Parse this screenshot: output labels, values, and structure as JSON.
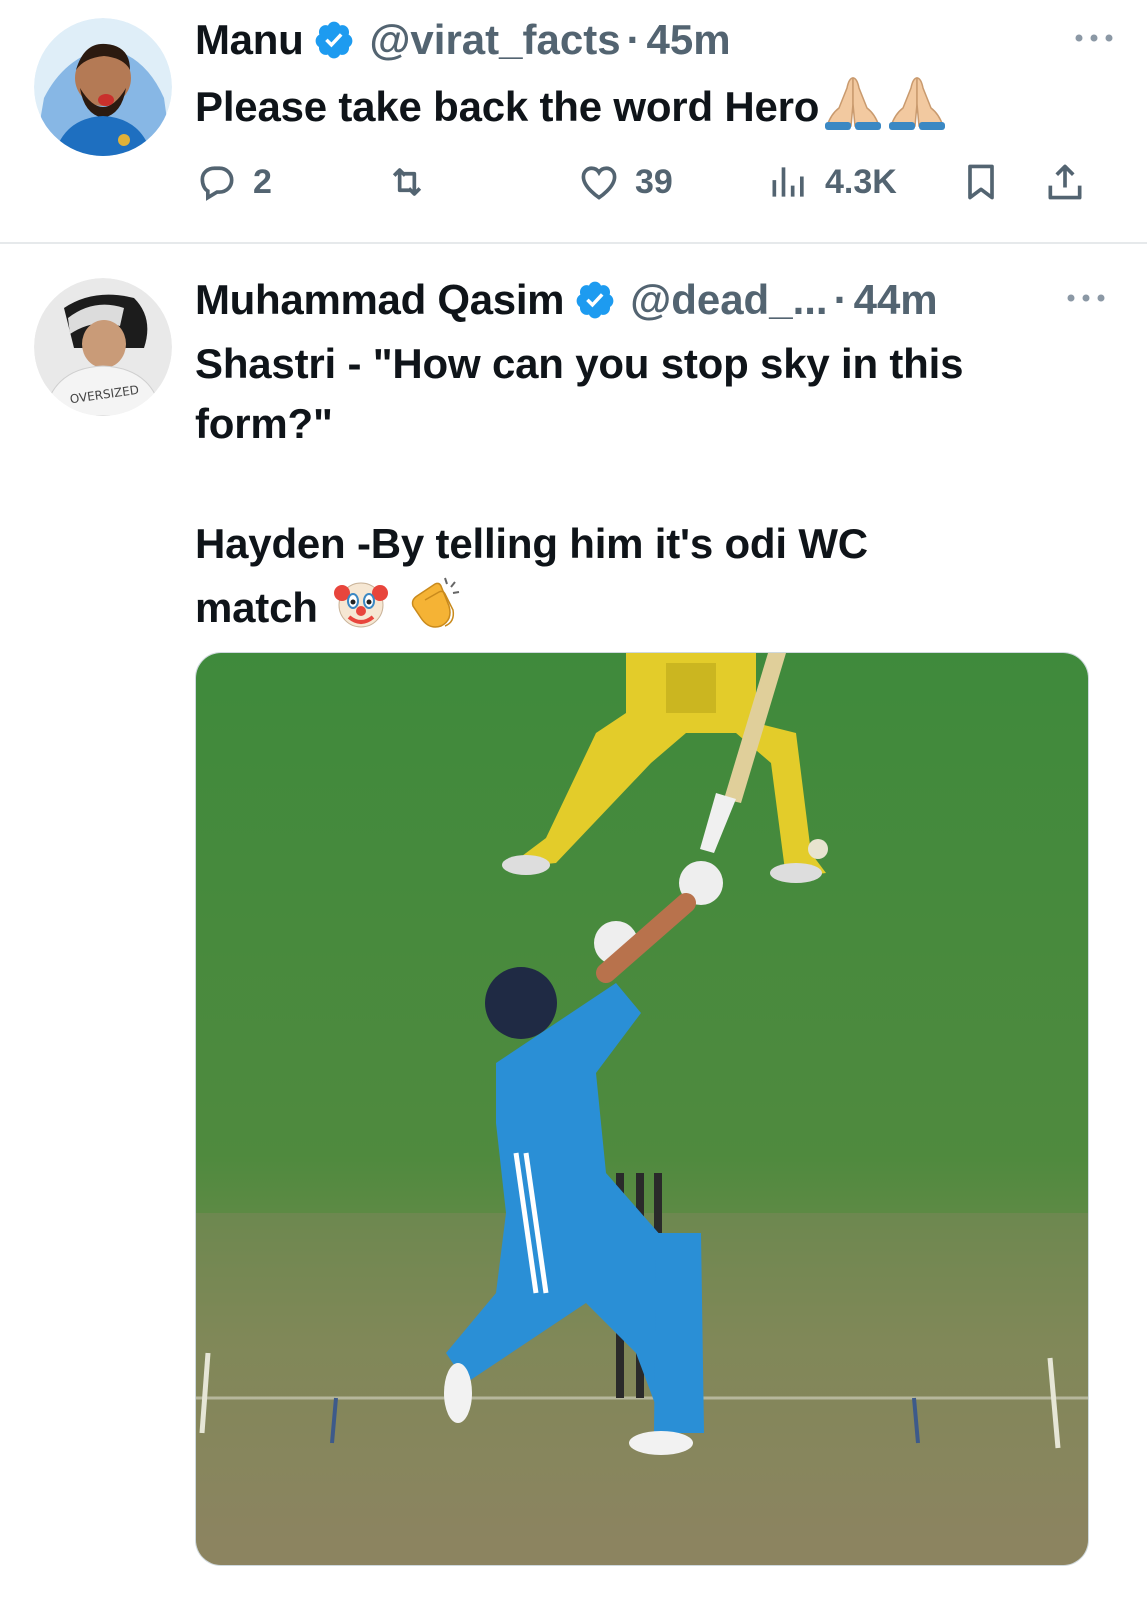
{
  "tweets": [
    {
      "author": "Manu",
      "handle": "@virat_facts",
      "separator": "·",
      "time": "45m",
      "text": "Please take back the word Hero",
      "emojis": [
        "folded-hands-icon",
        "folded-hands-icon"
      ],
      "stats": {
        "replies": "2",
        "retweets": "",
        "likes": "39",
        "views": "4.3K"
      }
    },
    {
      "author": "Muhammad Qasim",
      "handle": "@dead_...",
      "separator": "·",
      "time": "44m",
      "text_line1": "Shastri - \"How can you stop sky in this",
      "text_line2": "form?\"",
      "text_line3": "Hayden -By telling him it's odi WC",
      "text_line4": "match",
      "emojis": [
        "clown-face-icon",
        "clapping-hands-icon"
      ],
      "media": "cricket-batsman-photo"
    }
  ],
  "colors": {
    "verified": "#1d9bf0",
    "secondary_text": "#536471",
    "divider": "#e6e9eb"
  }
}
